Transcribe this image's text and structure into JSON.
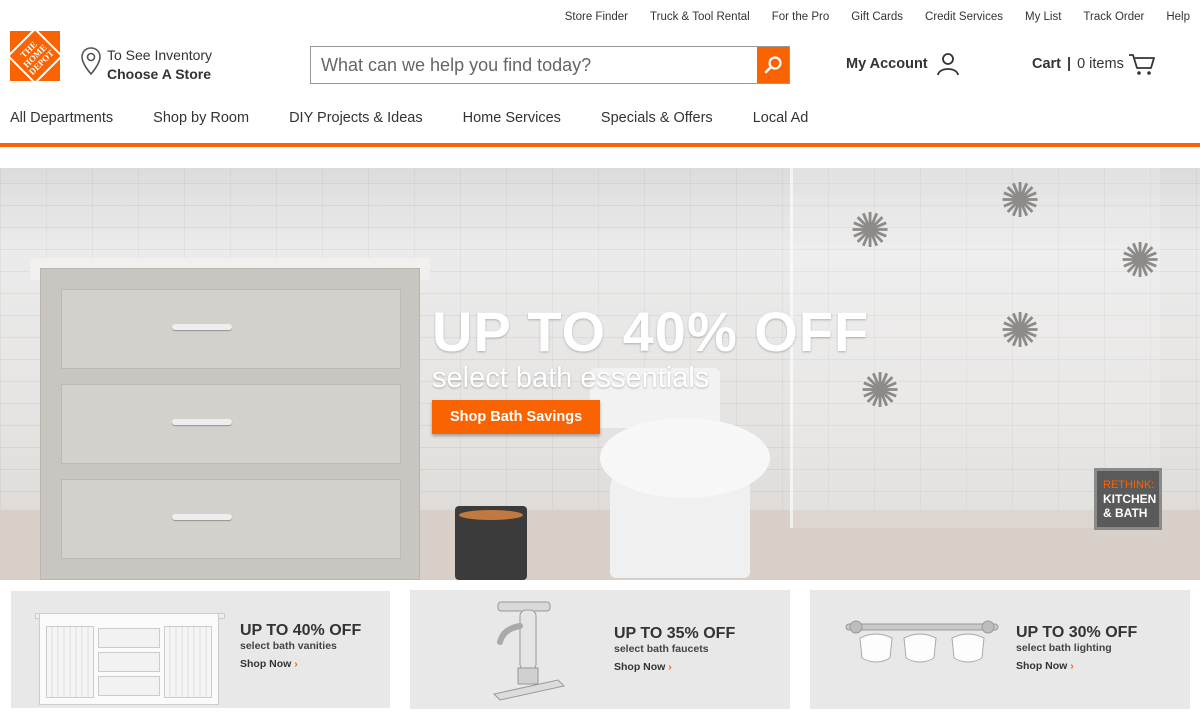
{
  "utility_links": [
    "Store Finder",
    "Truck & Tool Rental",
    "For the Pro",
    "Gift Cards",
    "Credit Services",
    "My List",
    "Track Order",
    "Help"
  ],
  "logo": {
    "text_lines": [
      "THE",
      "HOME",
      "DEPOT"
    ]
  },
  "store": {
    "line1": "To See Inventory",
    "line2": "Choose A Store"
  },
  "search": {
    "placeholder": "What can we help you find today?"
  },
  "account": {
    "label": "My Account"
  },
  "cart": {
    "label": "Cart",
    "separator": "|",
    "count_text": "0 items"
  },
  "nav": [
    "All Departments",
    "Shop by Room",
    "DIY Projects & Ideas",
    "Home Services",
    "Specials & Offers",
    "Local Ad"
  ],
  "hero": {
    "headline": "UP TO 40% OFF",
    "subhead": "select bath essentials",
    "cta": "Shop Bath Savings",
    "badge_line1": "RETHINK:",
    "badge_line2": "KITCHEN",
    "badge_line3": "& BATH"
  },
  "tiles": [
    {
      "headline": "UP TO 40% OFF",
      "sub": "select bath vanities",
      "link": "Shop Now",
      "arrow": "›"
    },
    {
      "headline": "UP TO 35% OFF",
      "sub": "select bath faucets",
      "link": "Shop Now",
      "arrow": "›"
    },
    {
      "headline": "UP TO 30% OFF",
      "sub": "select bath lighting",
      "link": "Shop Now",
      "arrow": "›"
    }
  ],
  "colors": {
    "brand_orange": "#f96302",
    "text": "#333333",
    "tile_bg": "#e8e8e8"
  },
  "icons": [
    "location-pin-icon",
    "search-icon",
    "user-icon",
    "cart-icon"
  ]
}
